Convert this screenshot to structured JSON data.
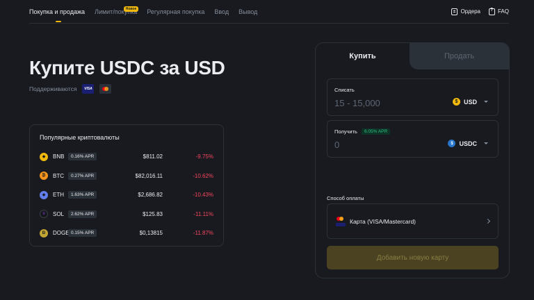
{
  "nav": {
    "tabs": [
      {
        "label": "Покупка и продажа",
        "active": true
      },
      {
        "label": "Лимит/покупка",
        "badge": "Новое"
      },
      {
        "label": "Регулярная покупка"
      },
      {
        "label": "Ввод"
      },
      {
        "label": "Вывод"
      }
    ],
    "orders_label": "Ордера",
    "faq_label": "FAQ"
  },
  "hero": {
    "title": "Купите USDC за USD",
    "supported_label": "Поддерживаются",
    "visa_label": "VISA"
  },
  "popular": {
    "title": "Популярные криптовалюты",
    "rows": [
      {
        "symbol": "BNB",
        "icon": "bnb-icon",
        "color": "#f0b90b",
        "glyph": "◆",
        "apr": "0.16% APR",
        "price": "$811.02",
        "change": "-9.75%"
      },
      {
        "symbol": "BTC",
        "icon": "btc-icon",
        "color": "#f7931a",
        "glyph": "₿",
        "apr": "0.27% APR",
        "price": "$82,016.11",
        "change": "-10.62%"
      },
      {
        "symbol": "ETH",
        "icon": "eth-icon",
        "color": "#627eea",
        "glyph": "◆",
        "apr": "1.63% APR",
        "price": "$2,686.82",
        "change": "-10.43%"
      },
      {
        "symbol": "SOL",
        "icon": "sol-icon",
        "color": "#14161a",
        "glyph": "≡",
        "apr": "2.62% APR",
        "price": "$125.83",
        "change": "-11.11%"
      },
      {
        "symbol": "DOGE",
        "icon": "doge-icon",
        "color": "#c2a633",
        "glyph": "Ð",
        "apr": "0.15% APR",
        "price": "$0,13815",
        "change": "-11.87%"
      }
    ]
  },
  "trade": {
    "buy_tab": "Купить",
    "sell_tab": "Продать",
    "spend_label": "Списать",
    "spend_placeholder": "15 - 15,000",
    "spend_currency": "USD",
    "receive_label": "Получить",
    "receive_apr": "6.05% APR",
    "receive_value": "0",
    "receive_currency": "USDC",
    "payment_label": "Способ оплаты",
    "payment_method": "Карта (VISA/Mastercard)",
    "add_card_button": "Добавить новую карту"
  },
  "colors": {
    "accent": "#f0b90b",
    "negative": "#f6465d",
    "positive": "#2ebd85"
  }
}
